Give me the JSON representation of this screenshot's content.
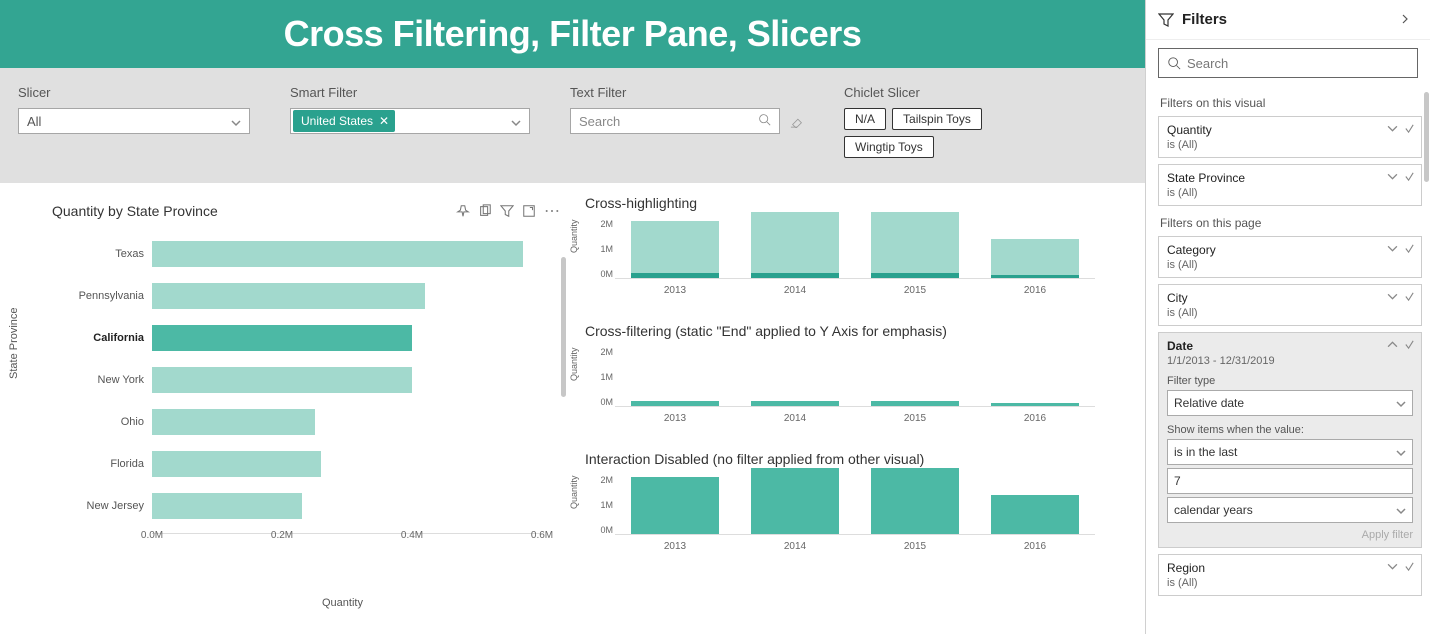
{
  "banner": {
    "title": "Cross Filtering, Filter Pane, Slicers"
  },
  "slicers": {
    "slicer": {
      "label": "Slicer",
      "value": "All"
    },
    "smart": {
      "label": "Smart Filter",
      "chip": "United States"
    },
    "text": {
      "label": "Text Filter",
      "placeholder": "Search"
    },
    "chiclet": {
      "label": "Chiclet Slicer",
      "items": [
        "N/A",
        "Tailspin Toys",
        "Wingtip Toys"
      ]
    }
  },
  "left_chart": {
    "title": "Quantity by State Province",
    "y_title": "State Province",
    "x_title": "Quantity",
    "ticks": [
      "0.0M",
      "0.2M",
      "0.4M",
      "0.6M"
    ]
  },
  "mini": {
    "t1": "Cross-highlighting",
    "t2": "Cross-filtering (static \"End\" applied to Y Axis for emphasis)",
    "t3": "Interaction Disabled (no filter applied from other visual)",
    "ylabel": "Quantity",
    "ticks": [
      "2M",
      "1M",
      "0M"
    ]
  },
  "filter_pane": {
    "title": "Filters",
    "search": "Search",
    "sec1": "Filters on this visual",
    "sec2": "Filters on this page",
    "is_all": "is (All)",
    "cards": {
      "quantity": "Quantity",
      "state": "State Province",
      "category": "Category",
      "city": "City",
      "region": "Region",
      "date": "Date",
      "date_sub": "1/1/2013 - 12/31/2019",
      "filter_type_label": "Filter type",
      "filter_type_value": "Relative date",
      "show_label": "Show items when the value:",
      "rel_op": "is in the last",
      "rel_val": "7",
      "rel_unit": "calendar years",
      "apply": "Apply filter"
    }
  },
  "chart_data": [
    {
      "type": "bar",
      "orientation": "horizontal",
      "title": "Quantity by State Province",
      "xlabel": "Quantity",
      "ylabel": "State Province",
      "xlim": [
        0,
        600000
      ],
      "categories": [
        "Texas",
        "Pennsylvania",
        "California",
        "New York",
        "Ohio",
        "Florida",
        "New Jersey"
      ],
      "values": [
        570000,
        420000,
        400000,
        400000,
        250000,
        260000,
        230000
      ],
      "highlighted": "California"
    },
    {
      "type": "bar",
      "title": "Cross-highlighting",
      "xlabel": "",
      "ylabel": "Quantity",
      "ylim": [
        0,
        2000000
      ],
      "categories": [
        "2013",
        "2014",
        "2015",
        "2016"
      ],
      "series": [
        {
          "name": "total",
          "values": [
            1900000,
            2200000,
            2200000,
            1300000
          ]
        },
        {
          "name": "highlighted",
          "values": [
            150000,
            180000,
            180000,
            100000
          ]
        }
      ]
    },
    {
      "type": "bar",
      "title": "Cross-filtering (static \"End\" applied to Y Axis for emphasis)",
      "xlabel": "",
      "ylabel": "Quantity",
      "ylim": [
        0,
        2000000
      ],
      "categories": [
        "2013",
        "2014",
        "2015",
        "2016"
      ],
      "values": [
        150000,
        180000,
        180000,
        100000
      ]
    },
    {
      "type": "bar",
      "title": "Interaction Disabled (no filter applied from other visual)",
      "xlabel": "",
      "ylabel": "Quantity",
      "ylim": [
        0,
        2000000
      ],
      "categories": [
        "2013",
        "2014",
        "2015",
        "2016"
      ],
      "values": [
        1900000,
        2200000,
        2200000,
        1300000
      ]
    }
  ]
}
